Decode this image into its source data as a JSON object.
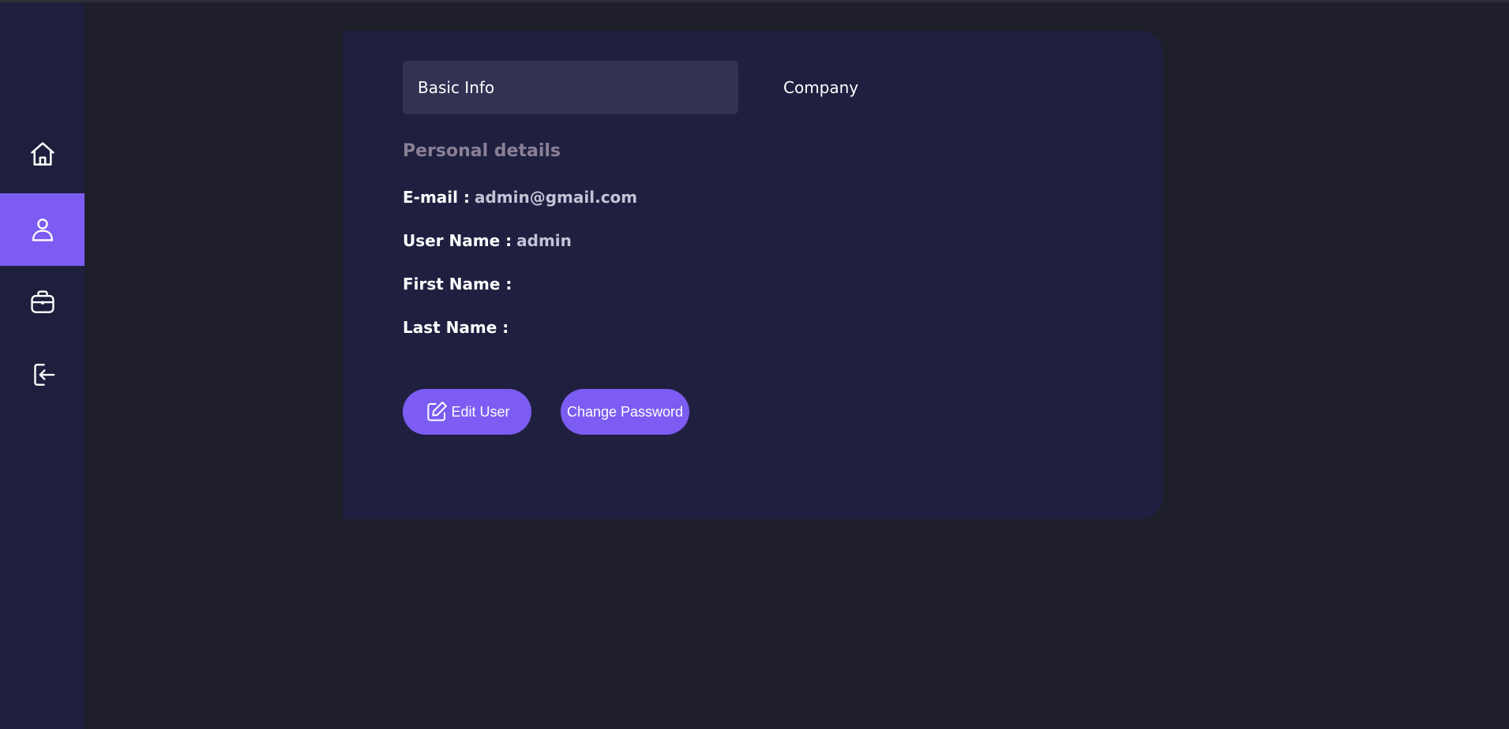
{
  "sidebar": {
    "items": [
      {
        "icon": "home-icon",
        "active": false
      },
      {
        "icon": "user-icon",
        "active": true
      },
      {
        "icon": "briefcase-icon",
        "active": false
      },
      {
        "icon": "logout-icon",
        "active": false
      }
    ]
  },
  "tabs": {
    "basic_info": "Basic Info",
    "company": "Company"
  },
  "section": {
    "title": "Personal details"
  },
  "fields": {
    "email_label": "E-mail :",
    "email_value": "admin@gmail.com",
    "username_label": "User Name :",
    "username_value": "admin",
    "firstname_label": "First Name :",
    "firstname_value": "",
    "lastname_label": "Last Name :",
    "lastname_value": ""
  },
  "buttons": {
    "edit_user": "Edit User",
    "change_password": "Change Password"
  },
  "colors": {
    "accent": "#7c5cf2",
    "sidebar_bg": "#1e1f3d",
    "card_bg": "#1f2040",
    "page_bg": "#1f1f2b"
  }
}
